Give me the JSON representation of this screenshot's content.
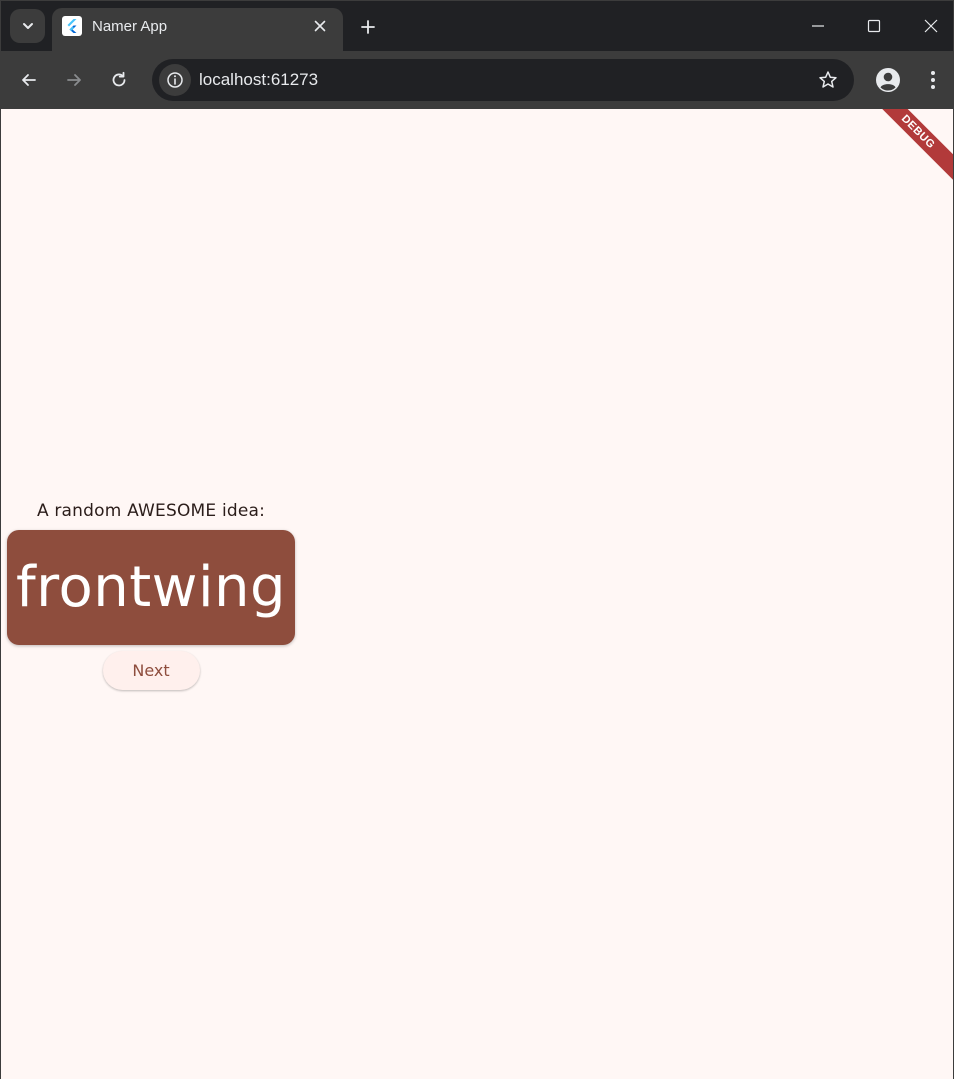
{
  "browser": {
    "tab_title": "Namer App",
    "url": "localhost:61273",
    "icons": {
      "tab_search": "chevron-down-icon",
      "favicon": "flutter-logo-icon",
      "close_tab": "close-icon",
      "new_tab": "plus-icon",
      "minimize": "minimize-icon",
      "maximize": "maximize-icon",
      "close_window": "close-icon",
      "back": "arrow-left-icon",
      "forward": "arrow-right-icon",
      "reload": "reload-icon",
      "site_info": "info-icon",
      "bookmark": "star-icon",
      "profile": "account-icon",
      "menu": "more-vertical-icon"
    }
  },
  "app": {
    "debug_banner": "DEBUG",
    "idea_label": "A random AWESOME idea:",
    "current_word": "frontwing",
    "next_label": "Next",
    "colors": {
      "background": "#fff7f5",
      "card": "#8e4d3d",
      "button_bg": "#fff0ed",
      "button_text": "#8e4d3d",
      "debug_banner": "#b23a3a"
    }
  }
}
